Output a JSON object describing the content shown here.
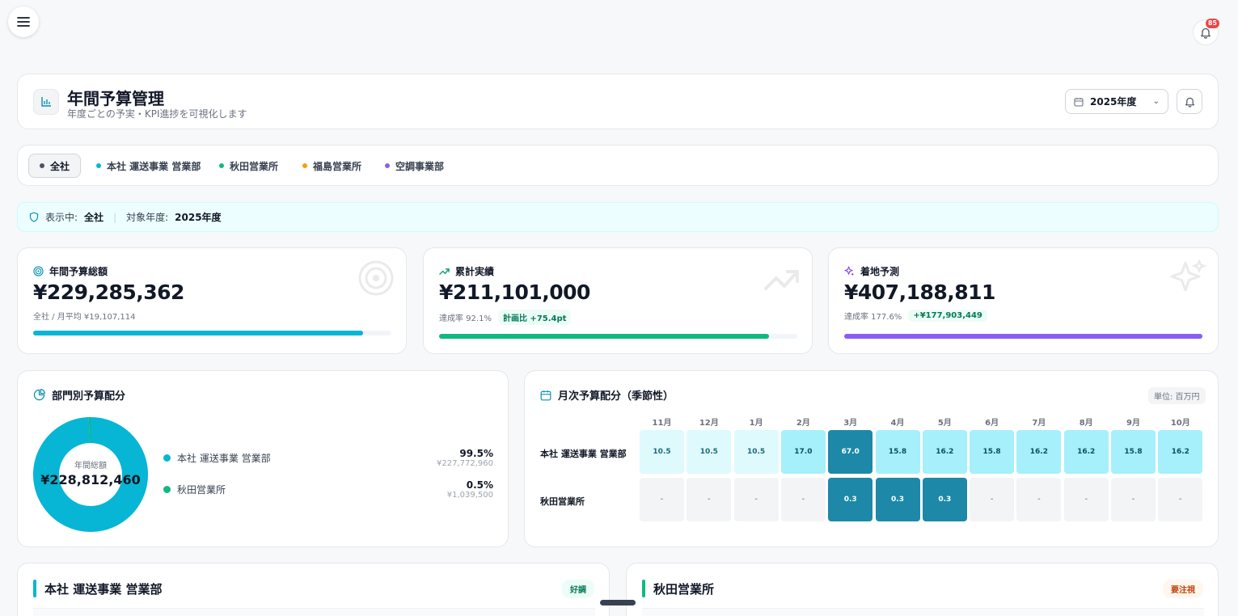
{
  "notifications": {
    "count": "85"
  },
  "header": {
    "title": "年間予算管理",
    "subtitle": "年度ごとの予実・KPI進捗を可視化します",
    "year": "2025年度"
  },
  "tabs": [
    {
      "label": "全社",
      "color": "#475569"
    },
    {
      "label": "本社 運送事業 営業部",
      "color": "#06b6d4"
    },
    {
      "label": "秋田営業所",
      "color": "#10b981"
    },
    {
      "label": "福島営業所",
      "color": "#f59e0b"
    },
    {
      "label": "空調事業部",
      "color": "#8b5cf6"
    }
  ],
  "info": {
    "showing_label": "表示中:",
    "showing_value": "全社",
    "year_label": "対象年度:",
    "year_value": "2025年度"
  },
  "kpis": {
    "budget": {
      "label": "年間予算総額",
      "value": "¥229,285,362",
      "sub": "全社 / 月平均 ¥19,107,114",
      "progress": 0.92,
      "color": "#06b6d4"
    },
    "actual": {
      "label": "累計実績",
      "value": "¥211,101,000",
      "sub": "達成率 92.1%",
      "pill": "計画比 +75.4pt",
      "progress": 0.921,
      "color": "#10b981"
    },
    "forecast": {
      "label": "着地予測",
      "value": "¥407,188,811",
      "sub": "達成率 177.6%",
      "pill": "+¥177,903,449",
      "progress": 1.0,
      "color": "#8b5cf6"
    }
  },
  "allocation": {
    "title": "部門別予算配分",
    "center_label": "年間総額",
    "center_value": "¥228,812,460",
    "items": [
      {
        "name": "本社 運送事業 営業部",
        "pct": "99.5%",
        "amount": "¥227,772,960",
        "share": 0.995,
        "color": "#06b6d4"
      },
      {
        "name": "秋田営業所",
        "pct": "0.5%",
        "amount": "¥1,039,500",
        "share": 0.005,
        "color": "#10b981"
      }
    ]
  },
  "monthly": {
    "title": "月次予算配分（季節性）",
    "unit": "単位: 百万円",
    "months": [
      "11月",
      "12月",
      "1月",
      "2月",
      "3月",
      "4月",
      "5月",
      "6月",
      "7月",
      "8月",
      "9月",
      "10月"
    ],
    "rows": [
      {
        "name": "本社 運送事業 営業部",
        "values": [
          "10.5",
          "10.5",
          "10.5",
          "17.0",
          "67.0",
          "15.8",
          "16.2",
          "15.8",
          "16.2",
          "16.2",
          "15.8",
          "16.2"
        ]
      },
      {
        "name": "秋田営業所",
        "values": [
          "-",
          "-",
          "-",
          "-",
          "0.3",
          "0.3",
          "0.3",
          "-",
          "-",
          "-",
          "-",
          "-"
        ]
      }
    ]
  },
  "departments": [
    {
      "name": "本社 運送事業 営業部",
      "status": "好調",
      "color": "#06b6d4"
    },
    {
      "name": "秋田営業所",
      "status": "要注視",
      "color": "#10b981"
    }
  ]
}
